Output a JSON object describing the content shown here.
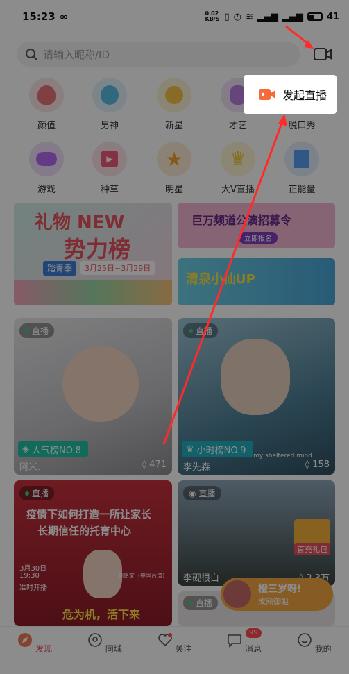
{
  "status": {
    "time": "15:23",
    "speed": "0.02 KB/S",
    "battery": "41"
  },
  "search": {
    "placeholder": "请输入昵称/ID"
  },
  "categories": [
    {
      "label": "颜值",
      "color": "#f08a8a"
    },
    {
      "label": "男神",
      "color": "#6cc6e8"
    },
    {
      "label": "新星",
      "color": "#f5c542"
    },
    {
      "label": "才艺",
      "color": "#c18be0"
    },
    {
      "label": "脱口秀",
      "color": "#f5a742"
    },
    {
      "label": "游戏",
      "color": "#b56cf0"
    },
    {
      "label": "种草",
      "color": "#f05a7a"
    },
    {
      "label": "明星",
      "color": "#f5a030"
    },
    {
      "label": "大V直播",
      "color": "#f5c930"
    },
    {
      "label": "正能量",
      "color": "#5a9ff0"
    }
  ],
  "banners": {
    "main": {
      "line1": "礼物 NEW",
      "line2": "势力榜",
      "date": "3月25日~3月29日",
      "season": "踏青季"
    },
    "top_right": {
      "text": "巨万频道公演招募令",
      "sub": "立即报名"
    },
    "bottom_right": {
      "text": "清泉小仙UP"
    }
  },
  "cards": [
    {
      "tag": "直播",
      "rank": "人气榜NO.8",
      "name": "阿米.",
      "count": "471"
    },
    {
      "tag": "直播",
      "rank": "小时榜NO.9",
      "name": "李先森",
      "count": "158",
      "caption": "Colour in my sheltered mind"
    },
    {
      "tag": "直播",
      "title1": "疫情下如何打造一所让家长",
      "title2": "长期信任的托育中心",
      "date": "3月30日",
      "time": "19:30",
      "start": "准时开播",
      "person": "刘惠文（中国台湾）",
      "slogan": "危为机，活下来"
    },
    {
      "tag": "直播",
      "name": "李砚很白",
      "count": "2.3万",
      "gift": "首充礼包"
    },
    {
      "tag": "直播"
    }
  ],
  "floating": {
    "title": "橙三岁呀!",
    "sub": "成熟御姐"
  },
  "popup": {
    "label": "发起直播"
  },
  "tabs": [
    {
      "label": "发现",
      "active": true
    },
    {
      "label": "同城"
    },
    {
      "label": "关注"
    },
    {
      "label": "消息",
      "badge": "99"
    },
    {
      "label": "我的"
    }
  ]
}
